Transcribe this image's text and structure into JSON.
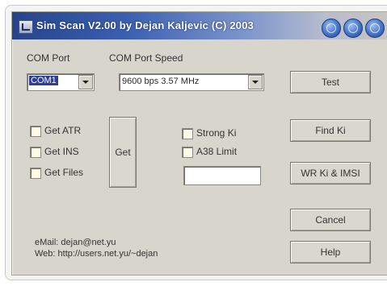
{
  "window": {
    "title": "Sim Scan V2.00 by Dejan Kaljevic (C) 2003"
  },
  "com_port": {
    "label": "COM Port",
    "value": "COM1"
  },
  "com_port_speed": {
    "label": "COM Port Speed",
    "value": "9600 bps  3.57 MHz"
  },
  "checkboxes": {
    "get_atr": "Get ATR",
    "get_ins": "Get INS",
    "get_files": "Get Files",
    "strong_ki": "Strong Ki",
    "a38_limit": "A38 Limit"
  },
  "buttons": {
    "get": "Get",
    "test": "Test",
    "find_ki": "Find Ki",
    "wr_ki_imsi": "WR Ki & IMSI",
    "cancel": "Cancel",
    "help": "Help"
  },
  "limit_value": "",
  "footer": {
    "email": "eMail:  dejan@net.yu",
    "web": "Web:  http://users.net.yu/~dejan"
  },
  "colors": {
    "titlebar_start": "#27448a",
    "titlebar_end": "#c8c6c0",
    "dialog_face": "#d8d6cc",
    "selection": "#2d3f9a"
  }
}
